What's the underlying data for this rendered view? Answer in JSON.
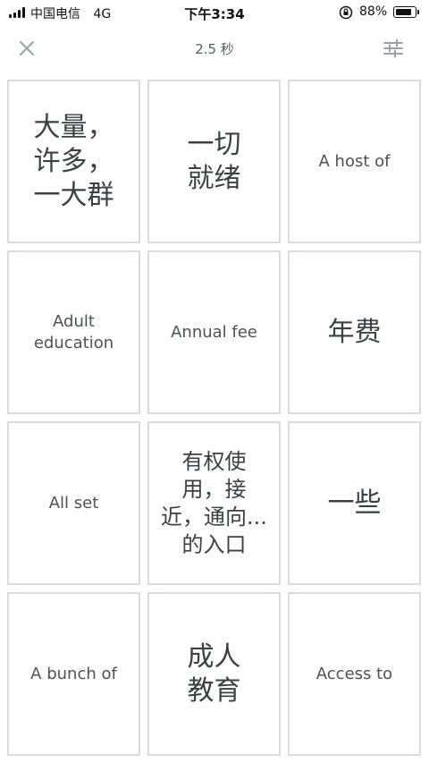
{
  "status_bar": {
    "carrier": "中国电信",
    "network": "4G",
    "time": "下午3:34",
    "battery_percent_label": "88%",
    "battery_level": 0.88,
    "icons": [
      "signal-icon",
      "orientation-lock-icon",
      "battery-icon"
    ]
  },
  "header": {
    "title": "2.5 秒",
    "close_icon": "close-icon",
    "settings_icon": "sliders-icon"
  },
  "cards": [
    {
      "text": "大量，\n许多，\n一大群",
      "lang": "zh"
    },
    {
      "text": "一切\n就绪",
      "lang": "zh"
    },
    {
      "text": "A host of",
      "lang": "en"
    },
    {
      "text": "Adult\neducation",
      "lang": "en"
    },
    {
      "text": "Annual fee",
      "lang": "en"
    },
    {
      "text": "年费",
      "lang": "zh"
    },
    {
      "text": "All set",
      "lang": "en"
    },
    {
      "text": "有权使\n用，接\n近，通向...\n的入口",
      "lang": "zh-small"
    },
    {
      "text": "一些",
      "lang": "zh"
    },
    {
      "text": "A bunch of",
      "lang": "en"
    },
    {
      "text": "成人\n教育",
      "lang": "zh"
    },
    {
      "text": "Access to",
      "lang": "en"
    }
  ],
  "colors": {
    "card_border": "#d9dcdd",
    "text_primary": "#3a4145",
    "icon_gray": "#9aa2a6"
  }
}
